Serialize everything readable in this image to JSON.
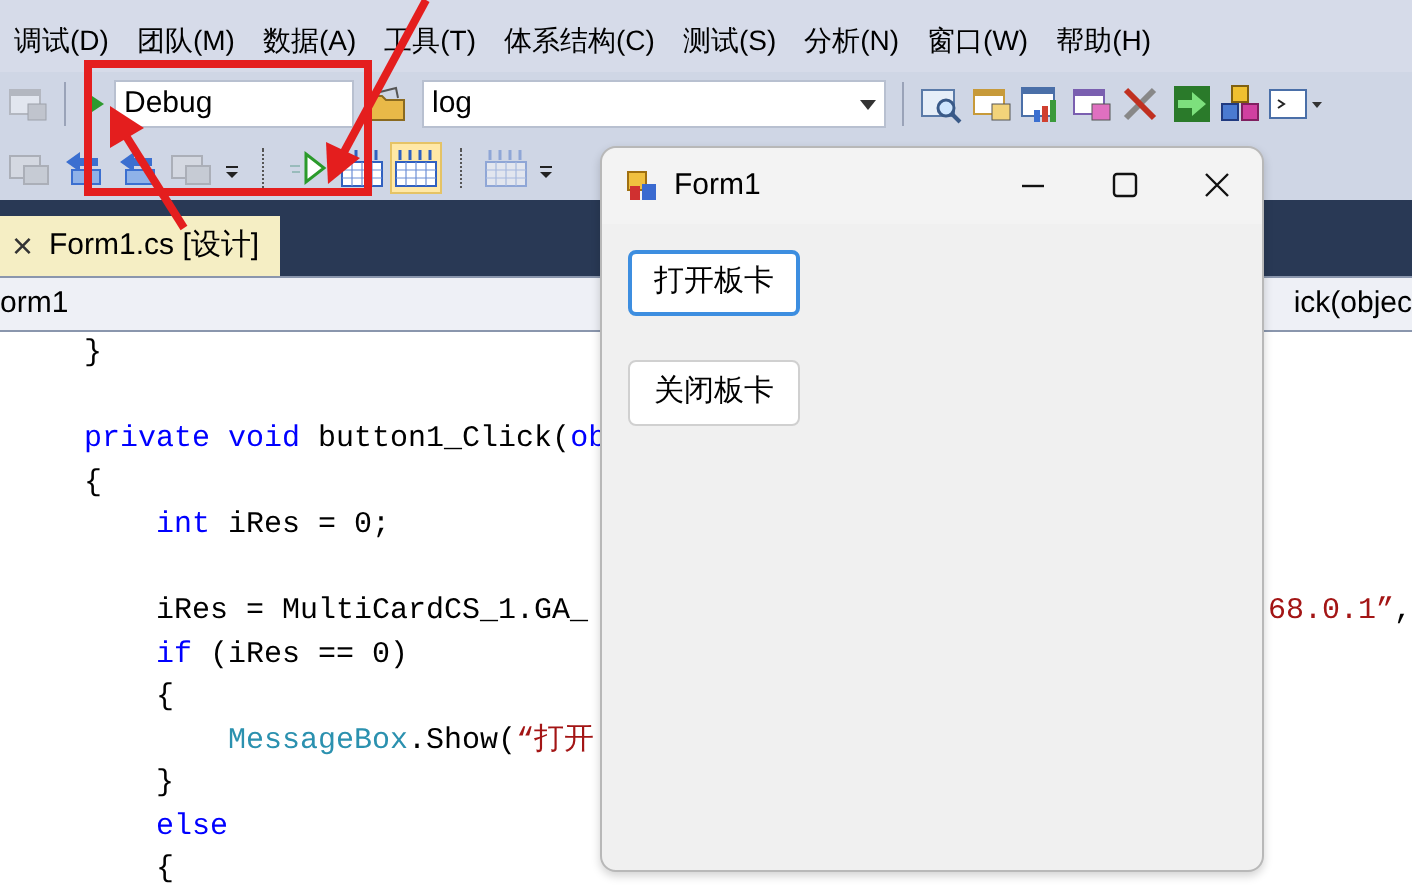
{
  "menu": [
    "调试(D)",
    "团队(M)",
    "数据(A)",
    "工具(T)",
    "体系结构(C)",
    "测试(S)",
    "分析(N)",
    "窗口(W)",
    "帮助(H)"
  ],
  "toolbar": {
    "configuration": "Debug",
    "target": "log"
  },
  "toolbar2": [
    {
      "kind": "window",
      "disabled": true,
      "pressed": false
    },
    {
      "kind": "arrows",
      "disabled": false,
      "pressed": false
    },
    {
      "kind": "arrows",
      "disabled": false,
      "pressed": false
    },
    {
      "kind": "window",
      "disabled": true,
      "pressed": false
    },
    {
      "kind": "dropdown",
      "disabled": false,
      "pressed": false
    },
    {
      "kind": "separator"
    },
    {
      "kind": "play",
      "disabled": false,
      "pressed": false
    },
    {
      "kind": "grid",
      "disabled": false,
      "pressed": false
    },
    {
      "kind": "grid",
      "disabled": false,
      "pressed": true
    },
    {
      "kind": "separator"
    },
    {
      "kind": "grid",
      "disabled": true,
      "pressed": false
    },
    {
      "kind": "dropdown",
      "disabled": false,
      "pressed": false
    }
  ],
  "tabs": [
    {
      "close": "×",
      "label": "Form1.cs [设计]",
      "selected": true
    }
  ],
  "navigation": {
    "left": "orm1",
    "right": "ick(objec"
  },
  "code": [
    {
      "kind": "code",
      "left": [
        {
          "kind": "plain",
          "text": "    }"
        }
      ]
    },
    {
      "kind": "blank"
    },
    {
      "kind": "code",
      "left": [
        {
          "kind": "keyword",
          "text": "    private void"
        },
        {
          "kind": "plain",
          "text": " button1_Click("
        },
        {
          "kind": "keyword",
          "text": "ob"
        }
      ]
    },
    {
      "kind": "code",
      "left": [
        {
          "kind": "plain",
          "text": "    {"
        }
      ]
    },
    {
      "kind": "code",
      "left": [
        {
          "kind": "keyword",
          "text": "        int"
        },
        {
          "kind": "plain",
          "text": " iRes = 0;"
        }
      ]
    },
    {
      "kind": "blank"
    },
    {
      "kind": "code",
      "left": [
        {
          "kind": "plain",
          "text": "        iRes = MultiCardCS_1.GA_"
        }
      ],
      "right": [
        {
          "kind": "string",
          "text": "68.0.1”"
        },
        {
          "kind": "plain",
          "text": ","
        }
      ]
    },
    {
      "kind": "code",
      "left": [
        {
          "kind": "keyword",
          "text": "        if"
        },
        {
          "kind": "plain",
          "text": " (iRes == 0)"
        }
      ]
    },
    {
      "kind": "code",
      "left": [
        {
          "kind": "plain",
          "text": "        {"
        }
      ]
    },
    {
      "kind": "code",
      "left": [
        {
          "kind": "type",
          "text": "            MessageBox"
        },
        {
          "kind": "plain",
          "text": ".Show("
        },
        {
          "kind": "string",
          "text": "“打开"
        }
      ]
    },
    {
      "kind": "code",
      "left": [
        {
          "kind": "plain",
          "text": "        }"
        }
      ]
    },
    {
      "kind": "code",
      "left": [
        {
          "kind": "keyword",
          "text": "        else"
        }
      ]
    },
    {
      "kind": "code",
      "left": [
        {
          "kind": "plain",
          "text": "        {"
        }
      ]
    }
  ],
  "form": {
    "title": "Form1",
    "buttons": [
      {
        "label": "打开板卡",
        "focused": true
      },
      {
        "label": "关闭板卡",
        "focused": false
      }
    ]
  }
}
